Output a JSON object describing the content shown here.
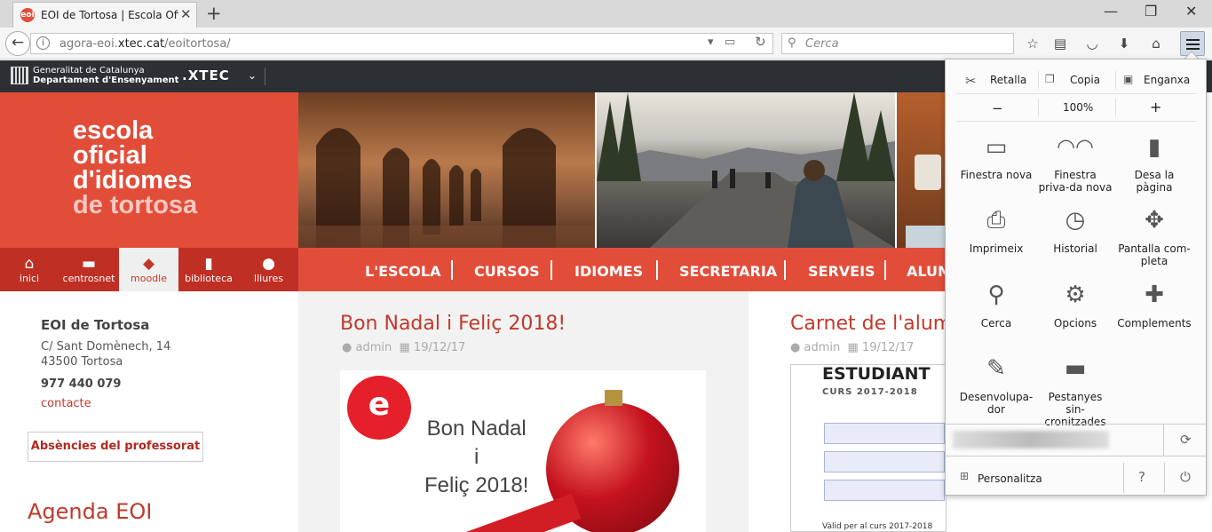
{
  "browser": {
    "tab_title": "EOI de Tortosa | Escola Ofi...",
    "tab_favicon": "eoi",
    "url_gray": "agora-eoi.",
    "url_dark": "xtec.cat",
    "url_rest": "/eoitortosa/",
    "search_placeholder": "Cerca",
    "window_controls": [
      "minimize-icon",
      "restore-icon",
      "close-icon"
    ]
  },
  "xtec": {
    "gencat_line1": "Generalitat de Catalunya",
    "gencat_line2": "Departament d'Ensenyament",
    "brand": ".XTEC"
  },
  "logo": {
    "l1": "escola",
    "l2": "oficial",
    "l3": "d'idiomes",
    "l4": "de tortosa"
  },
  "quicklinks": [
    {
      "label": "inici",
      "icon": "home-icon"
    },
    {
      "label": "centrosnet",
      "icon": "folder-icon"
    },
    {
      "label": "moodle",
      "icon": "graduation-cap-icon"
    },
    {
      "label": "biblioteca",
      "icon": "book-icon"
    },
    {
      "label": "lliures",
      "icon": "globe-icon"
    }
  ],
  "mainnav": [
    "L'ESCOLA",
    "CURSOS",
    "IDIOMES",
    "SECRETARIA",
    "SERVEIS",
    "ALUM"
  ],
  "sidebar": {
    "title": "EOI de Tortosa",
    "address1": "C/ Sant Domènech, 14",
    "address2": "43500 Tortosa",
    "phone": "977 440 079",
    "contact": "contacte",
    "absence_button": "Absències del professorat",
    "agenda_title": "Agenda EOI"
  },
  "posts": [
    {
      "title": "Bon Nadal i Feliç 2018!",
      "author": "admin",
      "date": "19/12/17",
      "img_line1": "Bon Nadal",
      "img_line2": "i",
      "img_line3": "Feliç 2018!"
    },
    {
      "title": "Carnet de l'alumn",
      "author": "admin",
      "date": "19/12/17",
      "img_heading": "ESTUDIANT",
      "img_sub": "CURS 2017-2018",
      "img_footer": "Vàlid per al curs 2017-2018"
    }
  ],
  "menu_panel": {
    "edit": {
      "cut": "Retalla",
      "copy": "Copia",
      "paste": "Enganxa"
    },
    "zoom": {
      "minus": "−",
      "level": "100%",
      "plus": "+"
    },
    "items": [
      {
        "label": "Finestra nova",
        "icon": "new-window-icon"
      },
      {
        "label": "Finestra priva-da nova",
        "icon": "private-mask-icon"
      },
      {
        "label": "Desa la pàgina",
        "icon": "save-page-icon"
      },
      {
        "label": "Imprimeix",
        "icon": "printer-icon"
      },
      {
        "label": "Historial",
        "icon": "clock-icon"
      },
      {
        "label": "Pantalla com-pleta",
        "icon": "fullscreen-icon"
      },
      {
        "label": "Cerca",
        "icon": "search-icon"
      },
      {
        "label": "Opcions",
        "icon": "gear-icon"
      },
      {
        "label": "Complements",
        "icon": "puzzle-icon"
      },
      {
        "label": "Desenvolupa-dor",
        "icon": "wrench-icon"
      },
      {
        "label": "Pestanyes sin-cronitzades",
        "icon": "synced-tabs-icon"
      }
    ],
    "customize": "Personalitza"
  },
  "colors": {
    "brand_red": "#e24d3a",
    "dark_red": "#bf2f24",
    "xtec_bar": "#2c2f33"
  }
}
